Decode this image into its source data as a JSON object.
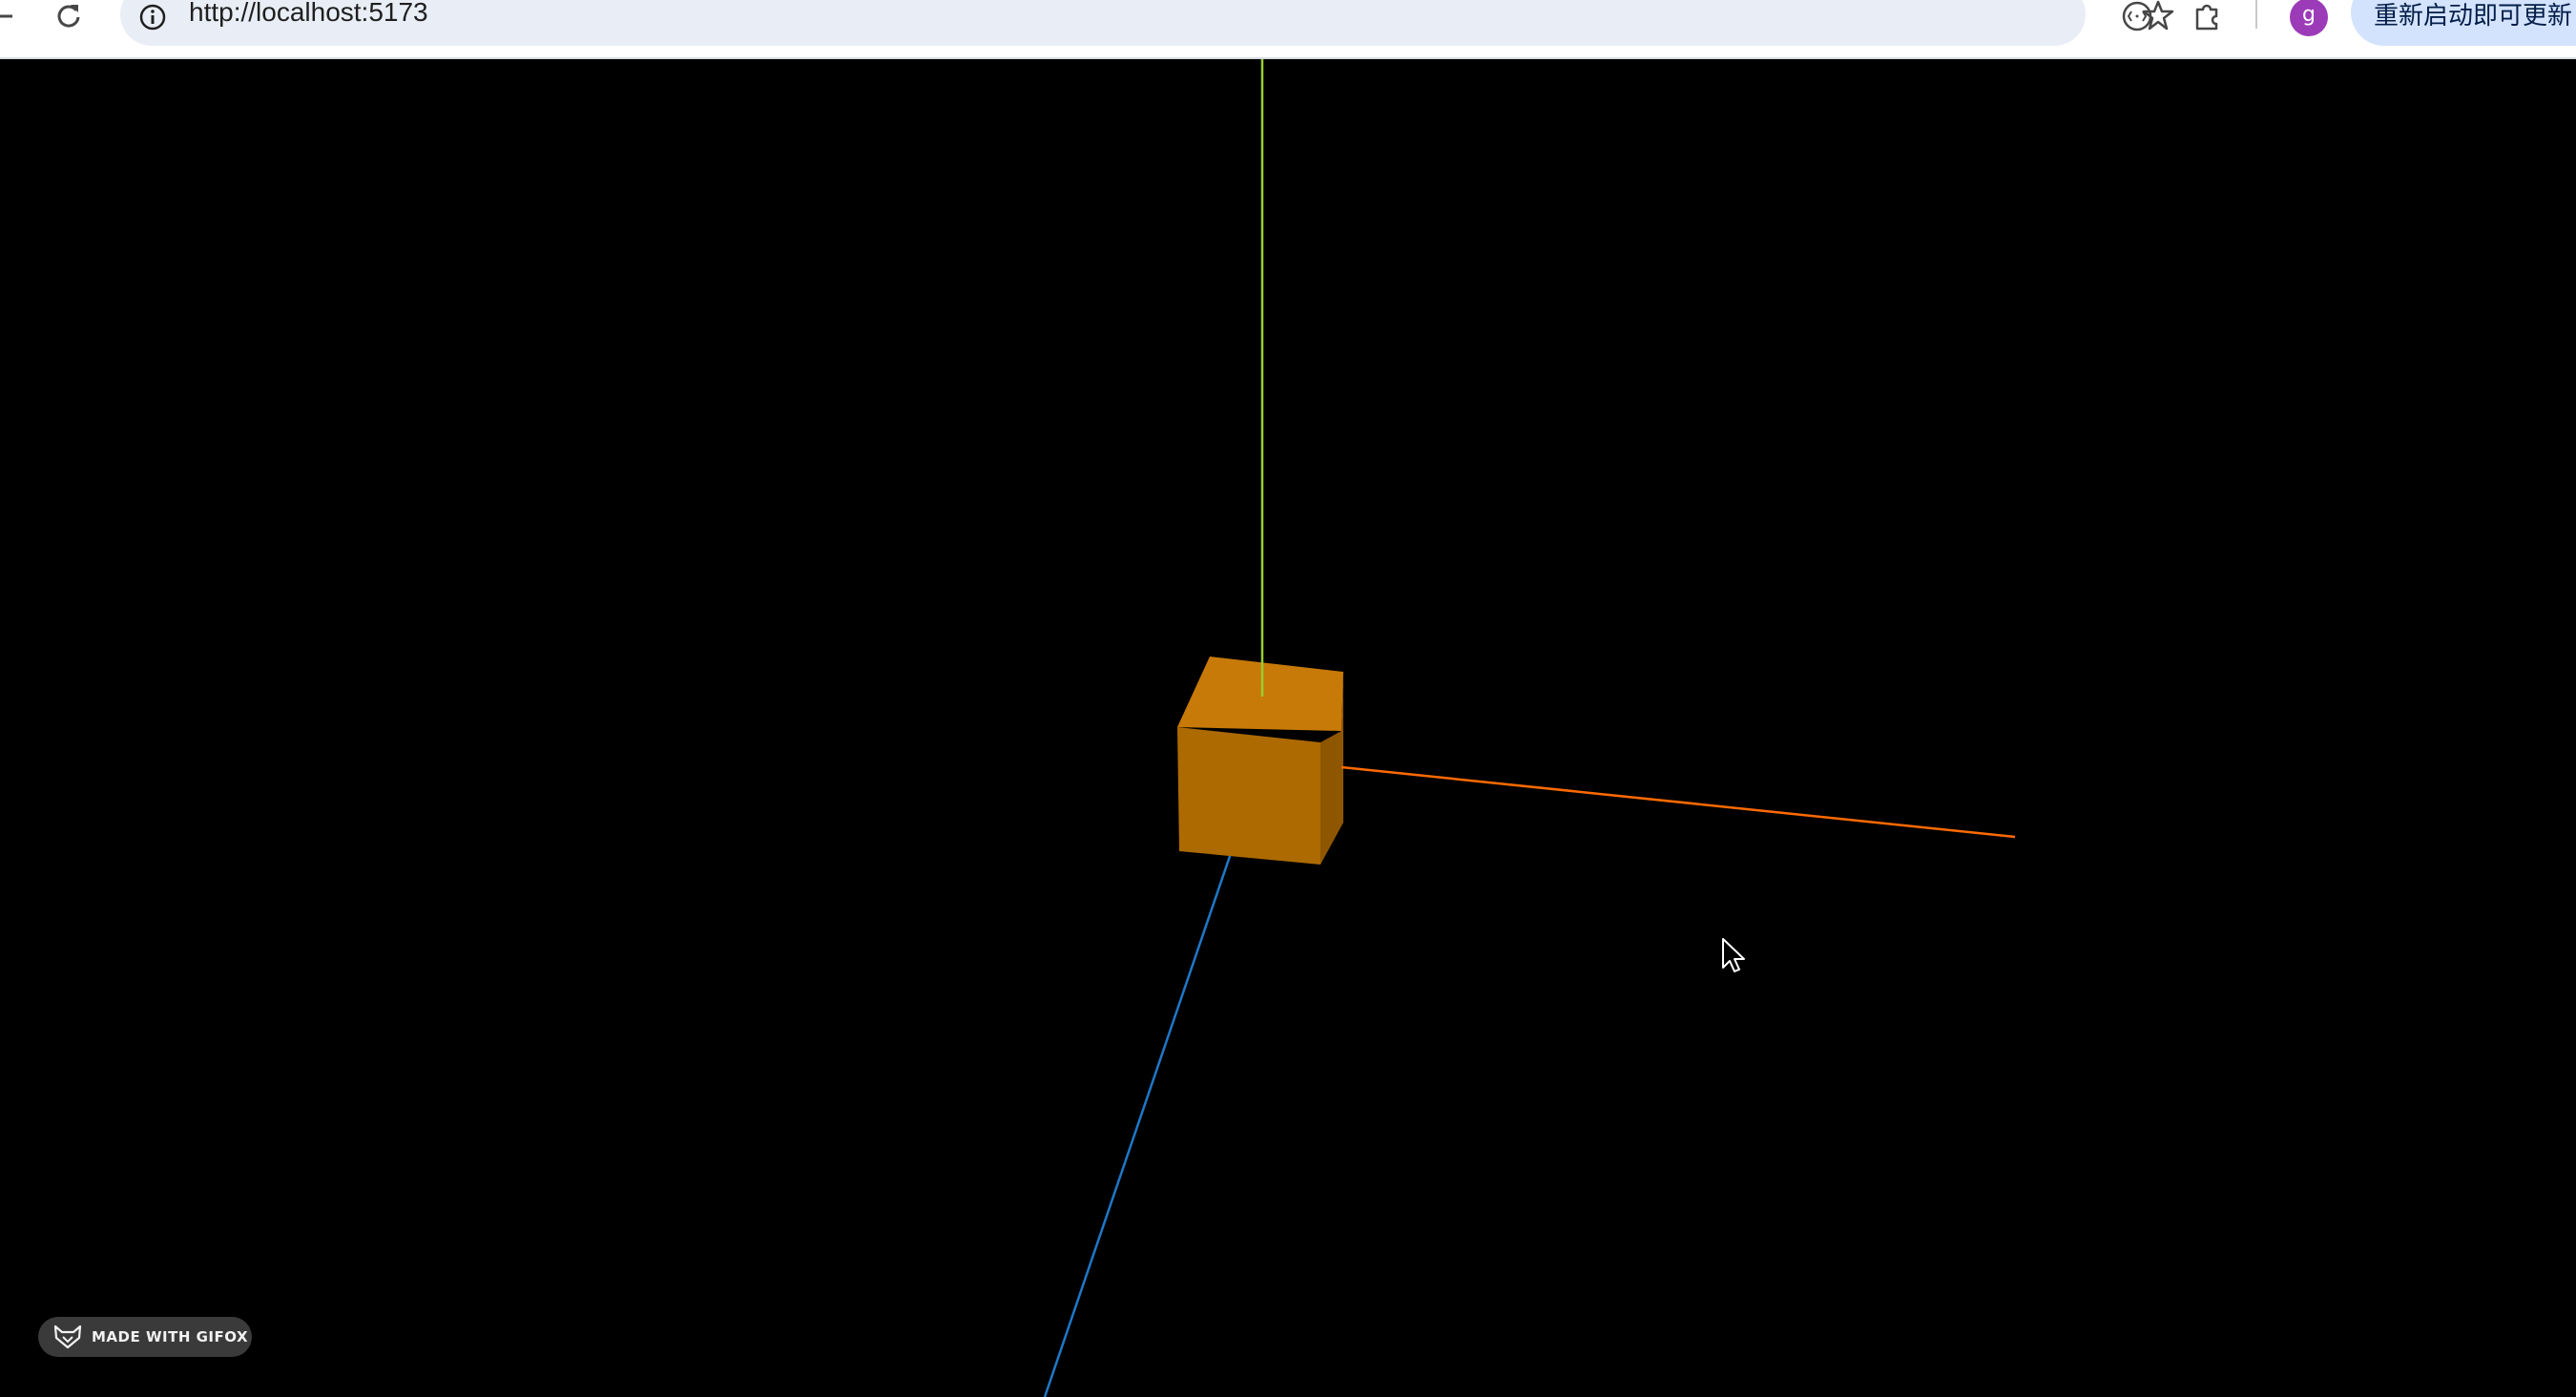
{
  "browser": {
    "url": "http://localhost:5173",
    "profile_initial": "g",
    "update_button_label": "重新启动即可更新",
    "icons": {
      "back": "arrow-left-icon",
      "reload": "reload-icon",
      "site_info": "info-icon",
      "bookmark": "star-icon",
      "media": "media-icon",
      "extensions": "puzzle-icon"
    }
  },
  "scene": {
    "background": "#000000",
    "cube_color": "#cc7a00",
    "axis_colors": {
      "x": "#ff6a00",
      "y": "#9acd32",
      "z": "#1e78c8"
    }
  },
  "watermark": {
    "label": "MADE WITH GIFOX",
    "icon": "fox-icon"
  }
}
